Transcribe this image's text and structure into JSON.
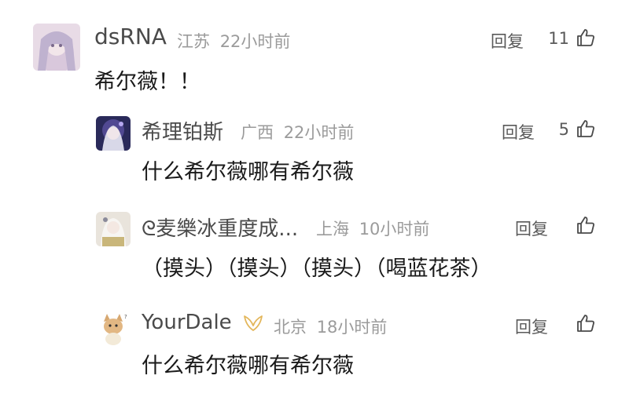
{
  "colors": {
    "name": "#4a4a4a",
    "meta": "#9b9b9b",
    "text": "#1a1a1a",
    "badge": "#e3b65a"
  },
  "comments": [
    {
      "username": "dsRNA",
      "location": "江苏",
      "time": "22小时前",
      "reply_label": "回复",
      "likes": "11",
      "text": "希尔薇！！",
      "avatar_icon": "anime-girl-avatar"
    },
    {
      "username": "希理铂斯",
      "location": "广西",
      "time": "22小时前",
      "reply_label": "回复",
      "likes": "5",
      "text": "什么希尔薇哪有希尔薇",
      "avatar_icon": "anime-silver-hair-avatar"
    },
    {
      "username": "ᘓ麦樂冰重度成...",
      "location": "上海",
      "time": "10小时前",
      "reply_label": "回复",
      "likes": "",
      "text": "（摸头）（摸头）（摸头）（喝蓝花茶）",
      "avatar_icon": "anime-white-hair-avatar"
    },
    {
      "username": "YourDale",
      "location": "北京",
      "time": "18小时前",
      "reply_label": "回复",
      "likes": "",
      "text": "什么希尔薇哪有希尔薇",
      "avatar_icon": "cat-avatar",
      "badge_icon": "wings-badge-icon"
    }
  ]
}
